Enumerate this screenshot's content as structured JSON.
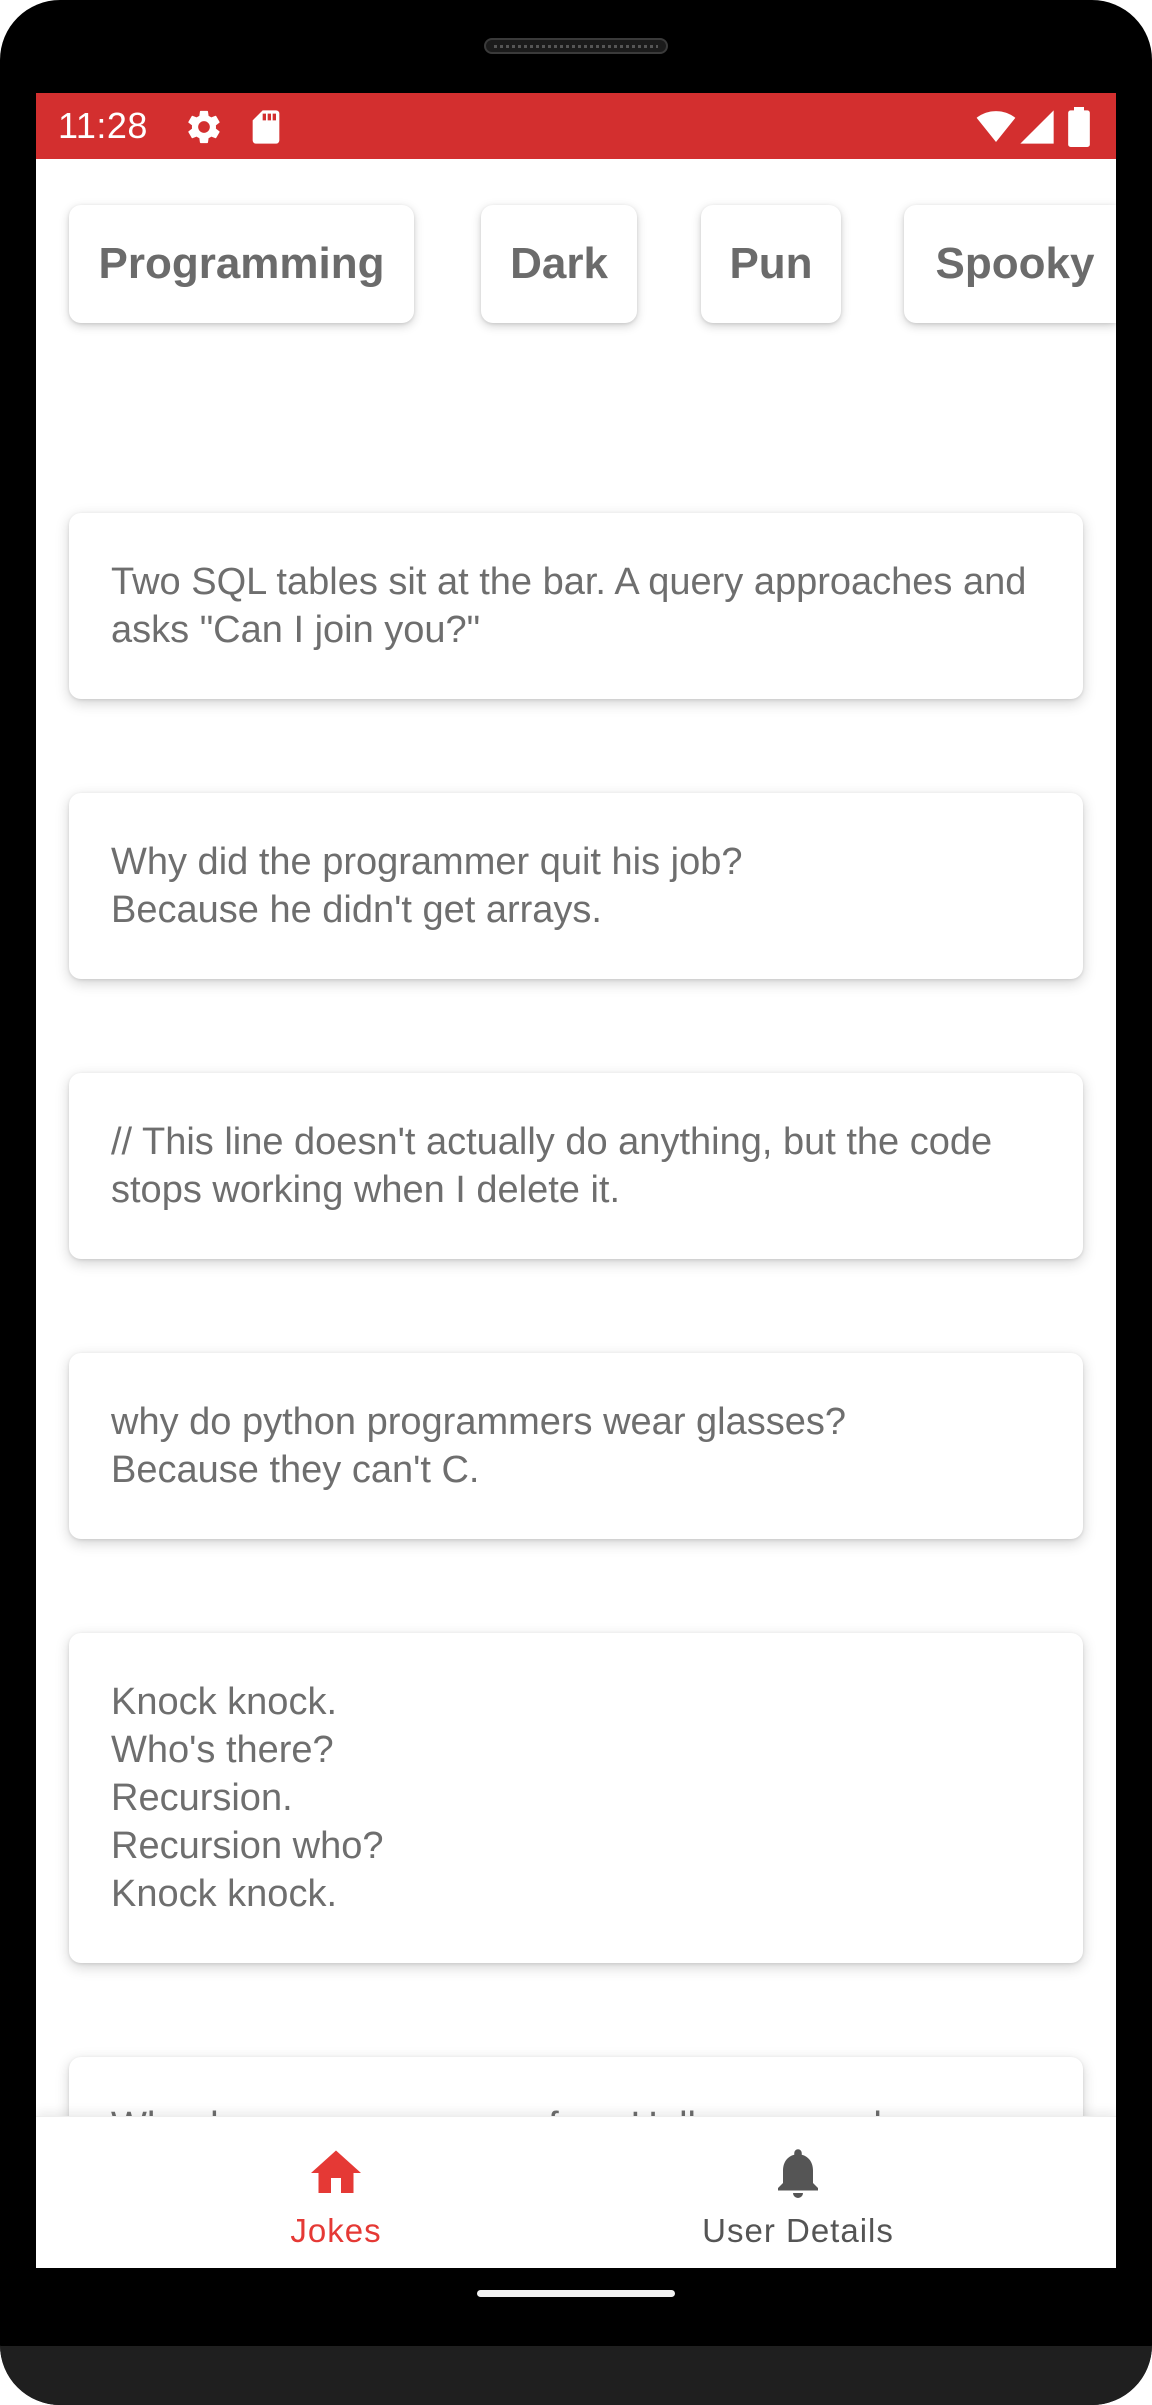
{
  "status_bar": {
    "time": "11:28",
    "color": "#d32f2f",
    "left_icons": [
      "gear-icon",
      "sd-card-icon"
    ],
    "right_icons": [
      "wifi-icon",
      "signal-icon",
      "battery-icon"
    ]
  },
  "categories": [
    {
      "label": "Programming",
      "selected": false
    },
    {
      "label": "Dark",
      "selected": false
    },
    {
      "label": "Pun",
      "selected": false
    },
    {
      "label": "Spooky",
      "selected": false
    }
  ],
  "jokes": [
    {
      "text": "Two SQL tables sit at the bar. A query approaches and asks \"Can I join you?\""
    },
    {
      "text": "Why did the programmer quit his job?\nBecause he didn't get arrays."
    },
    {
      "text": "// This line doesn't actually do anything, but the code stops working when I delete it."
    },
    {
      "text": "why do python programmers wear glasses?\nBecause they can't C."
    },
    {
      "text": "Knock knock.\nWho's there?\nRecursion.\nRecursion who?\nKnock knock."
    },
    {
      "text": "Why do programmers confuse Halloween and Christmas?"
    }
  ],
  "bottom_nav": {
    "items": [
      {
        "label": "Jokes",
        "icon": "home-icon",
        "active": true
      },
      {
        "label": "User Details",
        "icon": "bell-icon",
        "active": false
      }
    ],
    "active_color": "#e53935",
    "inactive_color": "#555555"
  }
}
